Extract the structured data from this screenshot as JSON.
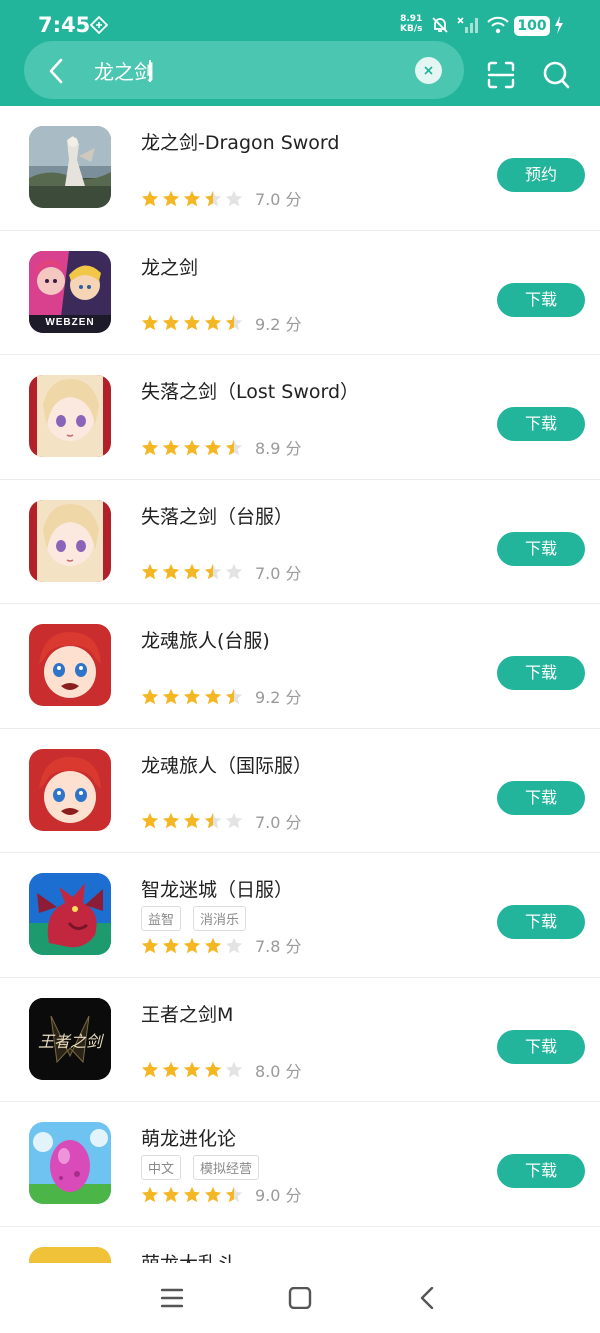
{
  "status_bar": {
    "time": "7:45",
    "net_speed": "8.91",
    "net_unit": "KB/s",
    "battery": "100"
  },
  "search": {
    "query": "龙之剑"
  },
  "results": [
    {
      "name": "龙之剑-Dragon Sword",
      "tags": [],
      "rating": 7.0,
      "score": "7.0 分",
      "action": "预约",
      "icon": "game-icon-dragon-sword"
    },
    {
      "name": "龙之剑",
      "tags": [],
      "rating": 9.2,
      "score": "9.2 分",
      "action": "下载",
      "icon": "game-icon-webzen",
      "icon_text": "WEBZEN"
    },
    {
      "name": "失落之剑（Lost Sword）",
      "tags": [],
      "rating": 8.9,
      "score": "8.9 分",
      "action": "下载",
      "icon": "game-icon-lost-sword"
    },
    {
      "name": "失落之剑（台服）",
      "tags": [],
      "rating": 7.0,
      "score": "7.0 分",
      "action": "下载",
      "icon": "game-icon-lost-sword-tw"
    },
    {
      "name": "龙魂旅人(台服)",
      "tags": [],
      "rating": 9.2,
      "score": "9.2 分",
      "action": "下载",
      "icon": "game-icon-dragon-soul-tw"
    },
    {
      "name": "龙魂旅人（国际服）",
      "tags": [],
      "rating": 7.0,
      "score": "7.0 分",
      "action": "下载",
      "icon": "game-icon-dragon-soul-intl"
    },
    {
      "name": "智龙迷城（日服）",
      "tags": [
        "益智",
        "消消乐"
      ],
      "rating": 7.8,
      "score": "7.8 分",
      "action": "下载",
      "icon": "game-icon-puzzle-dragons"
    },
    {
      "name": "王者之剑M",
      "tags": [],
      "rating": 8.0,
      "score": "8.0 分",
      "action": "下载",
      "icon": "game-icon-king-sword",
      "icon_text": "王者之剑"
    },
    {
      "name": "萌龙进化论",
      "tags": [
        "中文",
        "模拟经营"
      ],
      "rating": 9.0,
      "score": "9.0 分",
      "action": "下载",
      "icon": "game-icon-dragon-egg"
    },
    {
      "name": "萌龙大乱斗",
      "tags": [],
      "rating": null,
      "score": "",
      "action": "",
      "icon": "game-icon-cute-dragon"
    }
  ],
  "colors": {
    "accent": "#22b59b",
    "star": "#f5b623",
    "star_empty": "#e3e3e3"
  }
}
